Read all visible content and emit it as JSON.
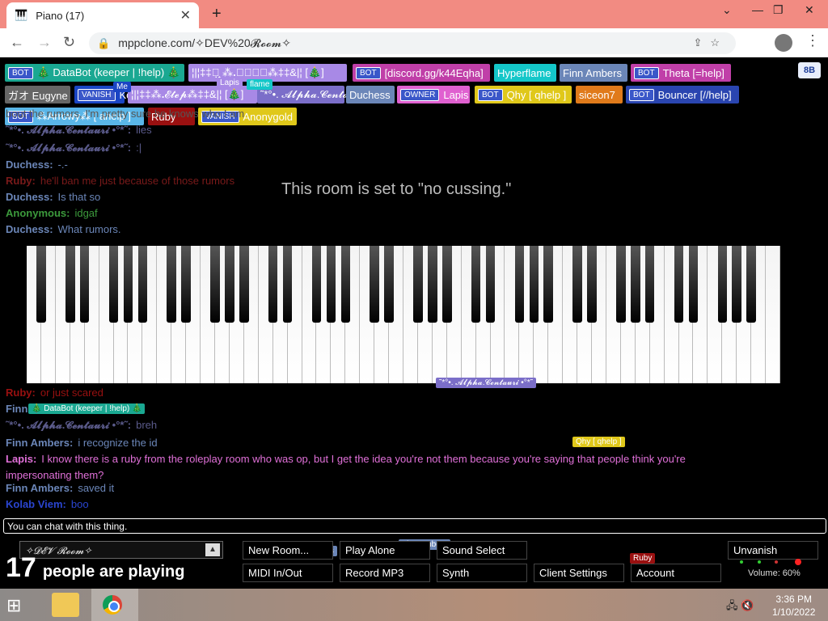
{
  "browser": {
    "tab_title": "Piano (17)",
    "url": "mppclone.com/✧DEV%20𝓡𝓸𝓸𝓶✧"
  },
  "badges": [
    {
      "label": "🎄 DataBot (keeper | !help) 🎄",
      "tag": "BOT",
      "color": "#1aa892"
    },
    {
      "label": "¦|¦‡‡☄̣͙̣͙͙͙̣̣͙͙̣̣͙͙̣̣͙͙ ⁂ꓸ𝓔𝓽𝓮𝓹⁂‡‡&|¦ [🎄]",
      "tag": "",
      "color": "#a889e6"
    },
    {
      "label": "[discord.gg/k44Eqha]",
      "tag": "BOT",
      "color": "#c03fa8"
    },
    {
      "label": "Hyperflame",
      "tag": "",
      "color": "#14c7c9"
    },
    {
      "label": "Finn Ambers",
      "tag": "",
      "color": "#6b86b8"
    },
    {
      "label": "Theta [=help]",
      "tag": "BOT",
      "color": "#c03fa8"
    },
    {
      "label": "ガオ Eugyne",
      "tag": "",
      "color": "#666"
    },
    {
      "label": "Ko",
      "tag": "VANISH",
      "color": "#1a45c4"
    },
    {
      "label": "¦|¦‡‡⁂ꓸ𝓔𝓽𝓮𝓹⁂‡‡&|¦ [🎄]",
      "tag": "",
      "color": "#a889e6"
    },
    {
      "label": "˜*°•. 𝓐𝓵𝓹𝓱𝓪.𝓒𝓮𝓷𝓽𝓪𝓾𝓻𝓲 •°*˜",
      "tag": "",
      "color": "#7b6ec9"
    },
    {
      "label": "Duchess",
      "tag": "",
      "color": "#6b86b8"
    },
    {
      "label": "Lapis",
      "tag": "OWNER",
      "color": "#e060d0"
    },
    {
      "label": "Qhy [ qhelp ]",
      "tag": "BOT",
      "color": "#e0c81a"
    },
    {
      "label": "siceon7",
      "tag": "",
      "color": "#e07a1a"
    },
    {
      "label": "Bouncer [//help]",
      "tag": "BOT",
      "color": "#2a45b0"
    },
    {
      "label": "⁂Arrowy⁂ [ ahelp ]",
      "tag": "BOT",
      "color": "#5ab6e8"
    },
    {
      "label": "Ruby",
      "tag": "",
      "color": "#9a1010"
    },
    {
      "label": "Anonygold",
      "tag": "VANISH",
      "color": "#e0c81a"
    }
  ],
  "eight": "8B",
  "notice": "This room is set to \"no cussing.\"",
  "chat": [
    {
      "name": "",
      "text": "bout the rumors, I'm pretty sure he knows who I am",
      "color": "#555"
    },
    {
      "name": "˜*°•. 𝓐𝓵𝓹𝓱𝓪.𝓒𝓮𝓷𝓽𝓪𝓾𝓻𝓲 •°*˜:",
      "text": "lies",
      "color": "#5a5a8a"
    },
    {
      "name": "˜*°•. 𝓐𝓵𝓹𝓱𝓪.𝓒𝓮𝓷𝓽𝓪𝓾𝓻𝓲 •°*˜:",
      "text": ":|",
      "color": "#5a5a8a"
    },
    {
      "name": "Duchess:",
      "text": "-.-",
      "color": "#6b86b8"
    },
    {
      "name": "Ruby:",
      "text": "he'll ban me just because of those rumors",
      "color": "#7a1a1a"
    },
    {
      "name": "Duchess:",
      "text": "Is that so",
      "color": "#6b86b8"
    },
    {
      "name": "Anonymous:",
      "text": "idgaf",
      "color": "#3c9a3c"
    },
    {
      "name": "Duchess:",
      "text": "What rumors.",
      "color": "#6b86b8"
    },
    {
      "name": "Ruby:",
      "text": "or just scared",
      "color": "#9a1010"
    },
    {
      "name": "Finn",
      "text": "",
      "color": "#6b86b8"
    },
    {
      "name": "˜*°•. 𝓐𝓵𝓹𝓱𝓪.𝓒𝓮𝓷𝓽𝓪𝓾𝓻𝓲 •°*˜:",
      "text": "breh",
      "color": "#5a5a8a"
    },
    {
      "name": "Finn Ambers:",
      "text": "i recognize the id",
      "color": "#6b86b8"
    },
    {
      "name": "Lapis:",
      "text": "I know there is a ruby from the roleplay room who was op, but I get the idea you're not them because you're saying that people think you're",
      "color": "#e070d8"
    },
    {
      "name": "",
      "text": "impersonating them?",
      "color": "#e070d8"
    },
    {
      "name": "Finn Ambers:",
      "text": "saved it",
      "color": "#6b86b8"
    },
    {
      "name": "Kolab Viem:",
      "text": "boo",
      "color": "#2a45d0"
    }
  ],
  "cursors": [
    {
      "label": "˜*°•. 𝓐𝓵𝓹𝓱𝓪.𝓒𝓮𝓷𝓽𝓪𝓾𝓻𝓲 •°*˜",
      "color": "#7b6ec9"
    },
    {
      "label": "🎄 DataBot (keeper | !help) 🎄",
      "color": "#1aa892"
    },
    {
      "label": "Qhy [ qhelp ]",
      "color": "#e0c81a"
    },
    {
      "label": "Anonygold",
      "color": "#e0c81a"
    },
    {
      "label": "Duchess",
      "color": "#6b86b8"
    },
    {
      "label": "Finn Ambers",
      "color": "#6b86b8"
    },
    {
      "label": "Ruby",
      "color": "#9a1010"
    },
    {
      "label": "Me",
      "color": "#1a45c4"
    },
    {
      "label": "Lapis",
      "color": "#a889e6"
    },
    {
      "label": "flame",
      "color": "#14c7c9"
    }
  ],
  "chat_placeholder": "You can chat with this thing.",
  "room": "✧𝓓𝓔𝓥 𝓡𝓸𝓸𝓶✧",
  "count": "17",
  "count_label": "people are playing",
  "buttons": [
    "New Room...",
    "Play Alone",
    "Sound Select",
    "Unvanish",
    "MIDI In/Out",
    "Record MP3",
    "Synth",
    "Client Settings",
    "Account"
  ],
  "volume": "Volume: 60%",
  "clock": {
    "time": "3:36 PM",
    "date": "1/10/2022"
  }
}
